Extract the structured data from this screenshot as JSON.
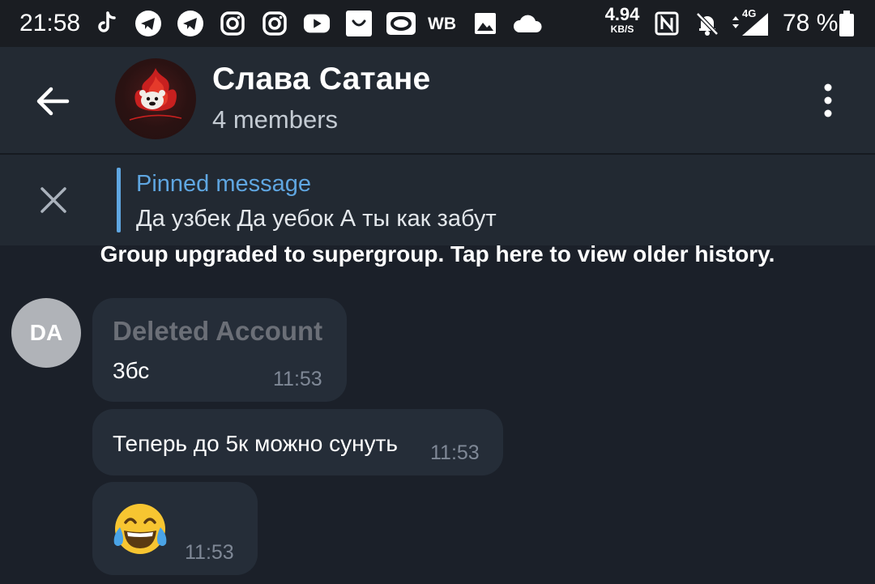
{
  "status_bar": {
    "time": "21:58",
    "notification_icons": [
      "tiktok-icon",
      "telegram-icon",
      "telegram-icon",
      "instagram-icon",
      "instagram-icon",
      "youtube-icon",
      "aliexpress-icon",
      "ozon-icon",
      "wb-icon",
      "gallery-icon",
      "cloud-icon"
    ],
    "wb_label": "WB",
    "net_speed": "4.94",
    "net_speed_unit": "KB/S",
    "network_type": "4G",
    "battery": "78 %"
  },
  "header": {
    "title": "Слава Сатане",
    "subtitle": "4 members"
  },
  "pinned": {
    "title": "Pinned message",
    "text": "Да узбек Да уебок А ты как забут"
  },
  "service_message": "Group upgraded to supergroup. Tap here to view older history.",
  "messages": [
    {
      "avatar_initials": "DA",
      "sender": "Deleted Account",
      "text": "3бс",
      "time": "11:53"
    },
    {
      "text": "Теперь до 5к можно сунуть",
      "time": "11:53"
    },
    {
      "emoji": "face-with-tears-of-joy",
      "time": "11:53"
    }
  ],
  "colors": {
    "background": "#1b2029",
    "header": "#232a33",
    "accent": "#5fa6e1",
    "bubble": "#252d38",
    "deleted_sender": "#6b6f77",
    "timestamp": "#7f8896"
  }
}
